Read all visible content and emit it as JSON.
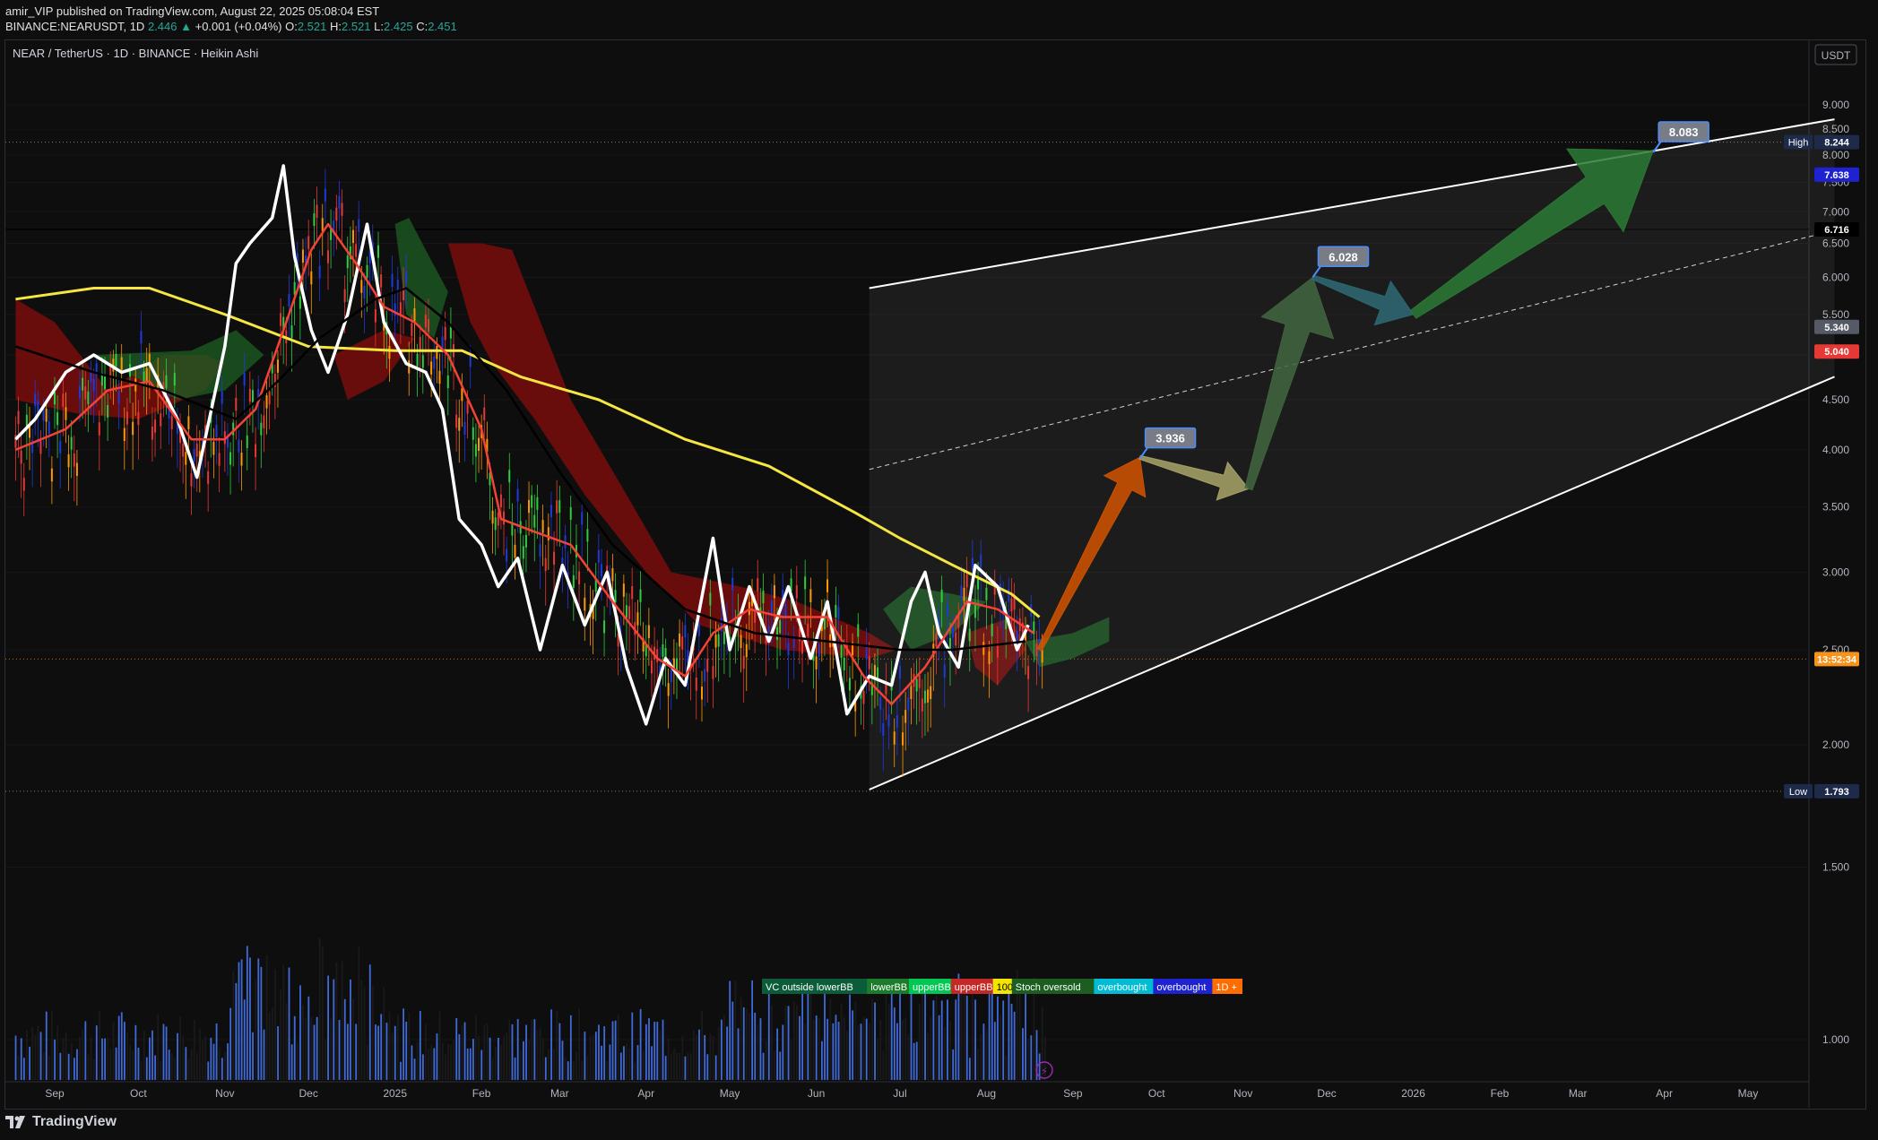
{
  "header": {
    "publisher_line": "amir_VIP published on TradingView.com, August 22, 2025 05:08:04 EST",
    "symbol": "BINANCE:NEARUSDT, 1D",
    "last": "2.446",
    "change": "+0.001 (+0.04%)",
    "o_label": "O:",
    "o": "2.521",
    "h_label": "H:",
    "h": "2.521",
    "l_label": "L:",
    "l": "2.425",
    "c_label": "C:",
    "c": "2.451"
  },
  "pane": {
    "title": "NEAR / TetherUS · 1D · BINANCE · Heikin Ashi",
    "currency_button": "USDT"
  },
  "footer": {
    "brand": "TradingView"
  },
  "indicator_tags": [
    "VC outside lowerBB",
    "lowerBB",
    "upperBB",
    "upperBB",
    "100",
    "Stoch oversold",
    "overbought",
    "overbought",
    "1D +"
  ],
  "price_badges": [
    {
      "label": "High",
      "value": "8.244",
      "bg": "#1e2a4a",
      "y": 8.244
    },
    {
      "label": "",
      "value": "7.638",
      "bg": "#1e22d0",
      "y": 7.638
    },
    {
      "label": "",
      "value": "6.716",
      "bg": "#000000",
      "y": 6.716
    },
    {
      "label": "",
      "value": "5.340",
      "bg": "#555a66",
      "y": 5.34
    },
    {
      "label": "",
      "value": "5.040",
      "bg": "#e53935",
      "y": 5.04
    },
    {
      "label": "",
      "value": "13:52:34",
      "bg": "#f7931a",
      "y": 2.446
    },
    {
      "label": "Low",
      "value": "1.793",
      "bg": "#1e2a4a",
      "y": 1.793
    }
  ],
  "targets": [
    {
      "label": "3.936",
      "x_date": "2025-09-25",
      "y": 3.936
    },
    {
      "label": "6.028",
      "x_date": "2025-11-26",
      "y": 6.028
    },
    {
      "label": "8.083",
      "x_date": "2026-03-28",
      "y": 8.083
    }
  ],
  "chart_data": {
    "type": "line",
    "title": "NEAR / TetherUS · 1D · BINANCE · Heikin Ashi",
    "y_scale": "log",
    "ylim": [
      0.87,
      9.9
    ],
    "y_ticks": [
      9.0,
      8.5,
      8.0,
      7.5,
      7.0,
      6.5,
      6.0,
      5.5,
      5.0,
      4.5,
      4.0,
      3.5,
      3.0,
      2.5,
      2.0,
      1.5,
      1.0
    ],
    "x_range": [
      "2024-08-17",
      "2026-06-15"
    ],
    "x_ticks": [
      {
        "label": "Sep",
        "date": "2024-09-01"
      },
      {
        "label": "Oct",
        "date": "2024-10-01"
      },
      {
        "label": "Nov",
        "date": "2024-11-01"
      },
      {
        "label": "Dec",
        "date": "2024-12-01"
      },
      {
        "label": "2025",
        "date": "2025-01-01"
      },
      {
        "label": "Feb",
        "date": "2025-02-01"
      },
      {
        "label": "Mar",
        "date": "2025-03-01"
      },
      {
        "label": "Apr",
        "date": "2025-04-01"
      },
      {
        "label": "May",
        "date": "2025-05-01"
      },
      {
        "label": "Jun",
        "date": "2025-06-01"
      },
      {
        "label": "Jul",
        "date": "2025-07-01"
      },
      {
        "label": "Aug",
        "date": "2025-08-01"
      },
      {
        "label": "Sep",
        "date": "2025-09-01"
      },
      {
        "label": "Oct",
        "date": "2025-10-01"
      },
      {
        "label": "Nov",
        "date": "2025-11-01"
      },
      {
        "label": "Dec",
        "date": "2025-12-01"
      },
      {
        "label": "2026",
        "date": "2026-01-01"
      },
      {
        "label": "Feb",
        "date": "2026-02-01"
      },
      {
        "label": "Mar",
        "date": "2026-03-01"
      },
      {
        "label": "Apr",
        "date": "2026-04-01"
      },
      {
        "label": "May",
        "date": "2026-05-01"
      }
    ],
    "high": 8.244,
    "low": 1.793,
    "series": [
      {
        "color": "#f5e642",
        "points": [
          [
            "2024-08-18",
            5.7
          ],
          [
            "2024-09-15",
            5.85
          ],
          [
            "2024-10-05",
            5.85
          ],
          [
            "2024-11-01",
            5.5
          ],
          [
            "2024-12-01",
            5.1
          ],
          [
            "2025-01-01",
            5.05
          ],
          [
            "2025-01-25",
            5.05
          ],
          [
            "2025-02-15",
            4.75
          ],
          [
            "2025-03-15",
            4.5
          ],
          [
            "2025-04-15",
            4.1
          ],
          [
            "2025-05-15",
            3.85
          ],
          [
            "2025-06-15",
            3.45
          ],
          [
            "2025-07-01",
            3.25
          ],
          [
            "2025-07-20",
            3.05
          ],
          [
            "2025-08-10",
            2.85
          ],
          [
            "2025-08-20",
            2.7
          ]
        ]
      },
      {
        "color": "#ffffff",
        "points": [
          [
            "2024-08-18",
            4.1
          ],
          [
            "2024-08-25",
            4.3
          ],
          [
            "2024-09-05",
            4.8
          ],
          [
            "2024-09-15",
            5.0
          ],
          [
            "2024-09-25",
            4.8
          ],
          [
            "2024-10-05",
            4.9
          ],
          [
            "2024-10-15",
            4.3
          ],
          [
            "2024-10-22",
            3.75
          ],
          [
            "2024-11-01",
            5.1
          ],
          [
            "2024-11-05",
            6.2
          ],
          [
            "2024-11-10",
            6.5
          ],
          [
            "2024-11-18",
            6.9
          ],
          [
            "2024-11-22",
            7.8
          ],
          [
            "2024-11-26",
            6.3
          ],
          [
            "2024-12-02",
            5.3
          ],
          [
            "2024-12-08",
            4.8
          ],
          [
            "2024-12-15",
            5.5
          ],
          [
            "2024-12-22",
            6.8
          ],
          [
            "2024-12-28",
            5.4
          ],
          [
            "2025-01-05",
            4.9
          ],
          [
            "2025-01-12",
            4.8
          ],
          [
            "2025-01-18",
            4.4
          ],
          [
            "2025-01-24",
            3.4
          ],
          [
            "2025-02-01",
            3.2
          ],
          [
            "2025-02-07",
            2.9
          ],
          [
            "2025-02-14",
            3.1
          ],
          [
            "2025-02-22",
            2.5
          ],
          [
            "2025-03-02",
            3.05
          ],
          [
            "2025-03-10",
            2.65
          ],
          [
            "2025-03-18",
            3.0
          ],
          [
            "2025-03-25",
            2.4
          ],
          [
            "2025-04-01",
            2.1
          ],
          [
            "2025-04-08",
            2.45
          ],
          [
            "2025-04-15",
            2.3
          ],
          [
            "2025-04-25",
            3.25
          ],
          [
            "2025-05-01",
            2.5
          ],
          [
            "2025-05-08",
            2.9
          ],
          [
            "2025-05-15",
            2.55
          ],
          [
            "2025-05-22",
            2.9
          ],
          [
            "2025-05-30",
            2.45
          ],
          [
            "2025-06-05",
            2.8
          ],
          [
            "2025-06-12",
            2.15
          ],
          [
            "2025-06-20",
            2.35
          ],
          [
            "2025-06-28",
            2.3
          ],
          [
            "2025-07-05",
            2.8
          ],
          [
            "2025-07-10",
            3.0
          ],
          [
            "2025-07-15",
            2.6
          ],
          [
            "2025-07-22",
            2.4
          ],
          [
            "2025-07-28",
            3.05
          ],
          [
            "2025-08-05",
            2.9
          ],
          [
            "2025-08-12",
            2.5
          ],
          [
            "2025-08-16",
            2.65
          ]
        ]
      },
      {
        "color": "#f44336",
        "points": [
          [
            "2024-08-18",
            4.0
          ],
          [
            "2024-09-05",
            4.2
          ],
          [
            "2024-09-20",
            4.6
          ],
          [
            "2024-10-05",
            4.7
          ],
          [
            "2024-10-20",
            4.1
          ],
          [
            "2024-11-01",
            4.1
          ],
          [
            "2024-11-12",
            4.4
          ],
          [
            "2024-11-22",
            5.3
          ],
          [
            "2024-12-02",
            6.4
          ],
          [
            "2024-12-08",
            6.8
          ],
          [
            "2024-12-18",
            6.2
          ],
          [
            "2024-12-28",
            5.6
          ],
          [
            "2025-01-08",
            5.4
          ],
          [
            "2025-01-20",
            5.0
          ],
          [
            "2025-02-01",
            4.2
          ],
          [
            "2025-02-08",
            3.4
          ],
          [
            "2025-02-20",
            3.3
          ],
          [
            "2025-03-05",
            3.2
          ],
          [
            "2025-03-20",
            2.8
          ],
          [
            "2025-04-05",
            2.45
          ],
          [
            "2025-04-15",
            2.35
          ],
          [
            "2025-04-25",
            2.6
          ],
          [
            "2025-05-08",
            2.75
          ],
          [
            "2025-05-20",
            2.7
          ],
          [
            "2025-06-05",
            2.7
          ],
          [
            "2025-06-18",
            2.35
          ],
          [
            "2025-06-28",
            2.2
          ],
          [
            "2025-07-10",
            2.4
          ],
          [
            "2025-07-25",
            2.8
          ],
          [
            "2025-08-05",
            2.75
          ],
          [
            "2025-08-18",
            2.6
          ]
        ]
      },
      {
        "color": "#000000",
        "points": [
          [
            "2024-08-18",
            5.1
          ],
          [
            "2024-09-15",
            4.8
          ],
          [
            "2024-10-10",
            4.6
          ],
          [
            "2024-11-05",
            4.3
          ],
          [
            "2024-11-20",
            4.7
          ],
          [
            "2024-12-05",
            5.2
          ],
          [
            "2024-12-25",
            5.7
          ],
          [
            "2025-01-05",
            5.85
          ],
          [
            "2025-01-20",
            5.4
          ],
          [
            "2025-02-10",
            4.6
          ],
          [
            "2025-03-01",
            3.8
          ],
          [
            "2025-03-20",
            3.2
          ],
          [
            "2025-04-15",
            2.75
          ],
          [
            "2025-05-10",
            2.6
          ],
          [
            "2025-06-05",
            2.55
          ],
          [
            "2025-07-01",
            2.5
          ],
          [
            "2025-07-20",
            2.5
          ],
          [
            "2025-08-15",
            2.55
          ]
        ]
      }
    ]
  }
}
